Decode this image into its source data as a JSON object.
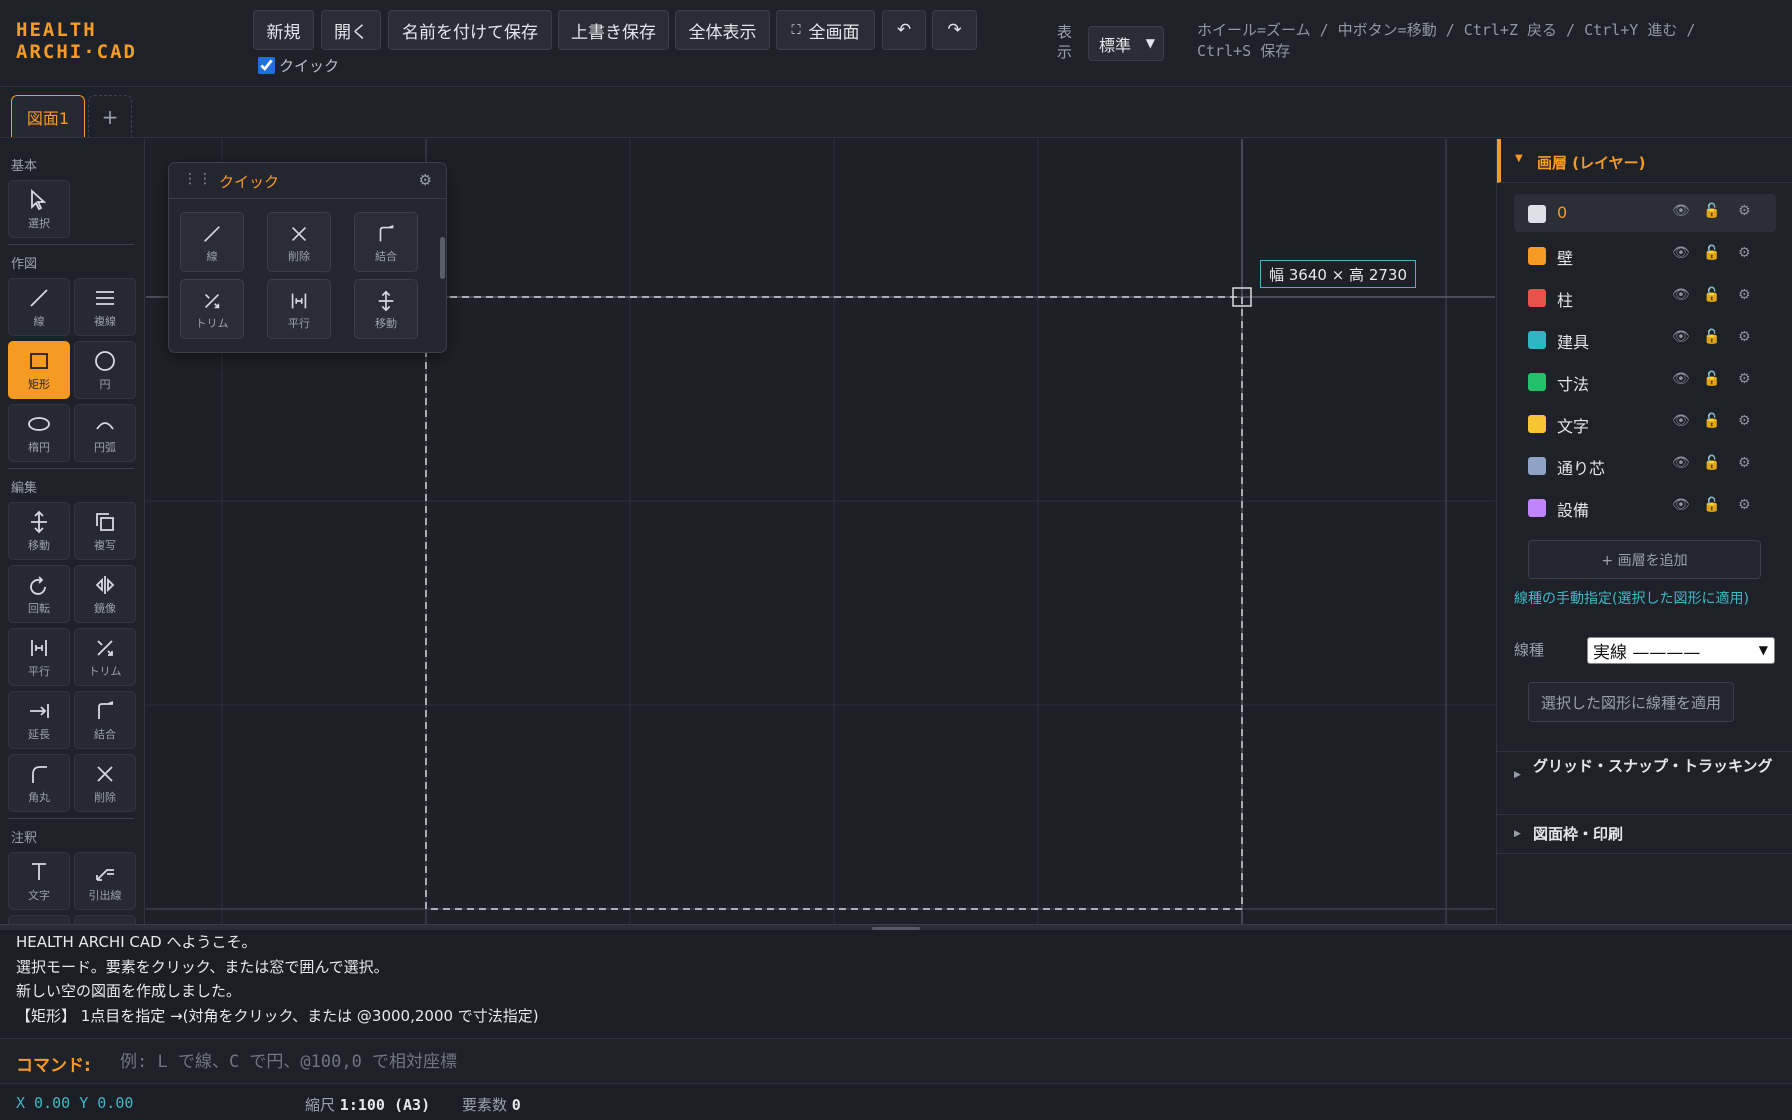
{
  "app": {
    "logo_line1": "HEALTH",
    "logo_line2": "ARCHI·CAD"
  },
  "toolbar": {
    "new": "新規",
    "open": "開く",
    "save_as": "名前を付けて保存",
    "overwrite": "上書き保存",
    "fit_all": "全体表示",
    "fullscreen": "全画面",
    "undo": "↶",
    "redo": "↷",
    "quick_checkbox": "クイック",
    "quick_checked": true,
    "view_label": "表示",
    "view_value": "標準",
    "hint": "ホイール=ズーム / 中ボタン=移動 / Ctrl+Z 戻る / Ctrl+Y 進む / Ctrl+S 保存"
  },
  "tabs": {
    "drawing": "図面1",
    "add": "+"
  },
  "palette": {
    "basic_label": "基本",
    "draw_label": "作図",
    "edit_label": "編集",
    "annot_label": "注釈",
    "tools": {
      "select": "選択",
      "line": "線",
      "multiline": "複線",
      "rect": "矩形",
      "circle": "円",
      "ellipse": "楕円",
      "arc": "円弧",
      "move": "移動",
      "copy": "複写",
      "rotate": "回転",
      "mirror": "鏡像",
      "parallel": "平行",
      "trim": "トリム",
      "extend": "延長",
      "join": "結合",
      "fillet": "角丸",
      "delete": "削除",
      "text": "文字",
      "leader": "引出線"
    },
    "active_tool": "rect"
  },
  "quick_panel": {
    "title": "クイック",
    "tools": [
      "線",
      "削除",
      "結合",
      "トリム",
      "平行",
      "移動"
    ]
  },
  "canvas": {
    "dimension_label": "幅 3640 × 高 2730"
  },
  "layers": {
    "title": "画層 (レイヤー)",
    "items": [
      {
        "name": "0",
        "color": "#dde0e6",
        "selected": true
      },
      {
        "name": "壁",
        "color": "#f59a23"
      },
      {
        "name": "柱",
        "color": "#e5534b"
      },
      {
        "name": "建具",
        "color": "#2fb6c2"
      },
      {
        "name": "寸法",
        "color": "#22c06a"
      },
      {
        "name": "文字",
        "color": "#f7c531"
      },
      {
        "name": "通り芯",
        "color": "#8fa3c7"
      },
      {
        "name": "設備",
        "color": "#c084fc"
      }
    ],
    "add_button": "+ 画層を追加",
    "linetype_note": "線種の手動指定(選択した図形に適用)",
    "linetype_label": "線種",
    "linetype_value": "実線 ————",
    "apply_button": "選択した図形に線種を適用"
  },
  "sections": {
    "grid_snap": "グリッド・スナップ・トラッキング",
    "frame_print": "図面枠・印刷"
  },
  "console": {
    "lines": [
      "HEALTH ARCHI CAD へようこそ。",
      "選択モード。要素をクリック、または窓で囲んで選択。",
      "新しい空の図面を作成しました。",
      "【矩形】 1点目を指定 →(対角をクリック、または @3000,2000 で寸法指定)"
    ],
    "command_label": "コマンド:",
    "command_placeholder": "例: L で線、C で円、@100,0 で相対座標"
  },
  "status": {
    "coords": "X 0.00  Y 0.00",
    "scale_label": "縮尺",
    "scale_value": "1:100 (A3)",
    "count_label": "要素数",
    "count_value": "0"
  }
}
